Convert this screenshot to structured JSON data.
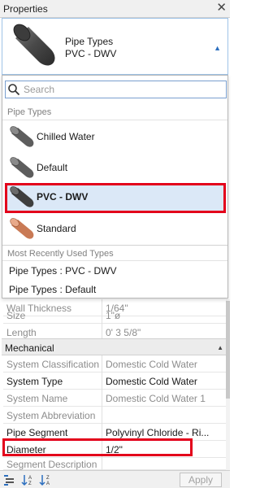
{
  "window": {
    "title": "Properties",
    "close_glyph": "✕"
  },
  "type_selector": {
    "family": "Pipe Types",
    "type": "PVC - DWV",
    "dropdown_arrow": "▲"
  },
  "dropdown": {
    "search_placeholder": "Search",
    "section_pipe_types": "Pipe Types",
    "items": [
      {
        "label": "Chilled Water",
        "color": "#6a6a6a"
      },
      {
        "label": "Default",
        "color": "#6a6a6a"
      },
      {
        "label": "PVC - DWV",
        "color": "#4a4a4a",
        "selected": true
      },
      {
        "label": "Standard",
        "color": "#c97a55"
      }
    ],
    "section_recent": "Most Recently Used Types",
    "recent": [
      "Pipe Types : PVC - DWV",
      "Pipe Types : Default"
    ]
  },
  "properties": {
    "dimensions": [
      {
        "name": "Wall Thickness",
        "value": "1/64\""
      },
      {
        "name": "Size",
        "value": "1\"ø"
      },
      {
        "name": "Length",
        "value": "0'  3 5/8\""
      }
    ],
    "group_mechanical": "Mechanical",
    "group_toggle": "▲",
    "mechanical": [
      {
        "name": "System Classification",
        "value": "Domestic Cold Water"
      },
      {
        "name": "System Type",
        "value": "Domestic Cold Water"
      },
      {
        "name": "System Name",
        "value": "Domestic Cold Water 1"
      },
      {
        "name": "System Abbreviation",
        "value": ""
      },
      {
        "name": "Pipe Segment",
        "value": "Polyvinyl Chloride - Ri..."
      },
      {
        "name": "Diameter",
        "value": "1/2\""
      },
      {
        "name": "Segment Description",
        "value": ""
      }
    ]
  },
  "bottom_bar": {
    "apply_label": "Apply"
  },
  "colors": {
    "highlight": "#e3001b",
    "accent": "#2c6fbf"
  }
}
